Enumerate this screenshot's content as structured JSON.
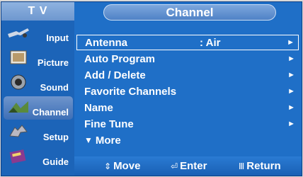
{
  "header": {
    "tv_label": "T V",
    "title": "Channel"
  },
  "sidebar": {
    "items": [
      {
        "label": "Input",
        "icon": "input-icon"
      },
      {
        "label": "Picture",
        "icon": "picture-icon"
      },
      {
        "label": "Sound",
        "icon": "sound-icon"
      },
      {
        "label": "Channel",
        "icon": "channel-icon"
      },
      {
        "label": "Setup",
        "icon": "setup-icon"
      },
      {
        "label": "Guide",
        "icon": "guide-icon"
      }
    ]
  },
  "menu": {
    "items": [
      {
        "label": "Antenna",
        "value": ": Air",
        "arrow": "►"
      },
      {
        "label": "Auto Program",
        "arrow": "►"
      },
      {
        "label": "Add / Delete",
        "arrow": "►"
      },
      {
        "label": "Favorite Channels",
        "arrow": "►"
      },
      {
        "label": "Name",
        "arrow": "►"
      },
      {
        "label": "Fine Tune",
        "arrow": "►"
      }
    ],
    "more": {
      "glyph": "▼",
      "label": "More"
    }
  },
  "footer": {
    "move": {
      "glyph": "⇕",
      "label": "Move"
    },
    "enter": {
      "glyph": "⏎",
      "label": "Enter"
    },
    "return": {
      "glyph": "Ⅲ",
      "label": "Return"
    }
  },
  "colors": {
    "panel_blue": "#1f6fc7",
    "highlight_blue": "#4f82c6",
    "white": "#ffffff"
  }
}
